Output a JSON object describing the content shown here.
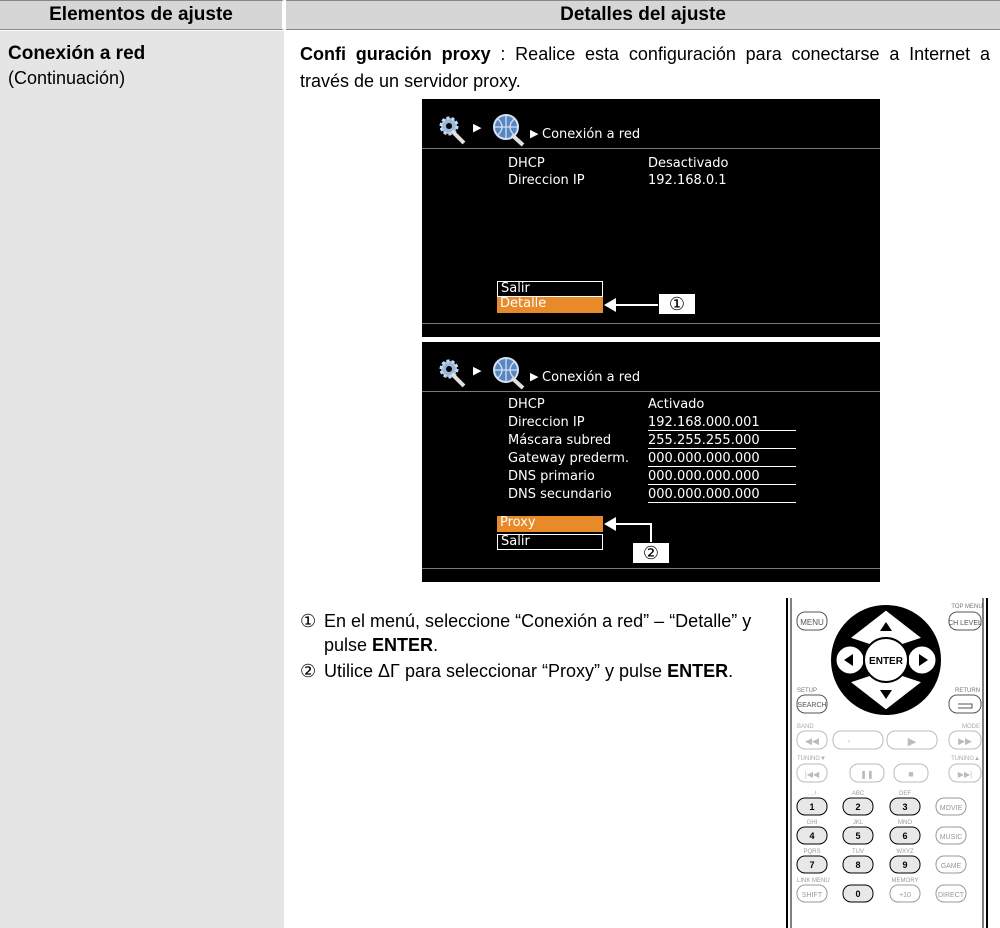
{
  "header": {
    "left": "Elementos de ajuste",
    "right": "Detalles del ajuste"
  },
  "left": {
    "title": "Conexión a red",
    "subtitle": "(Continuación)"
  },
  "intro": {
    "bold": "Confi guración proxy",
    "text": " : Realice esta configuración para conectarse a Internet a través de un servidor proxy."
  },
  "screen1": {
    "title": "Conexión a red",
    "rows": [
      {
        "label": "DHCP",
        "value": "Desactivado"
      },
      {
        "label": "Direccion IP",
        "value": "192.168.0.1"
      }
    ],
    "menu": [
      "Salir",
      "Detalle"
    ],
    "callout": "①"
  },
  "screen2": {
    "title": "Conexión a red",
    "rows": [
      {
        "label": "DHCP",
        "value": "Activado"
      },
      {
        "label": "Direccion IP",
        "value": "192.168.000.001"
      },
      {
        "label": "Máscara subred",
        "value": "255.255.255.000"
      },
      {
        "label": "Gateway prederm.",
        "value": "000.000.000.000"
      },
      {
        "label": "DNS primario",
        "value": "000.000.000.000"
      },
      {
        "label": "DNS secundario",
        "value": "000.000.000.000"
      }
    ],
    "menu": [
      "Proxy",
      "Salir"
    ],
    "callout": "②"
  },
  "steps": [
    {
      "num": "①",
      "text": "En el menú, seleccione “Conexión a red” – “Detalle” y pulse ",
      "key": "ENTER",
      "tail": "."
    },
    {
      "num": "②",
      "text": "Utilice ΔΓ para seleccionar “Proxy” y pulse ",
      "key": "ENTER",
      "tail": "."
    }
  ],
  "remote": {
    "menu": "MENU",
    "top_menu": "TOP MENU",
    "ch_level": "CH LEVEL",
    "enter": "ENTER",
    "setup": "SETUP",
    "search": "SEARCH",
    "return": "RETURN",
    "band": "BAND",
    "mode": "MODE",
    "tuning_down": "TUNING▼",
    "tuning_up": "TUNING▲",
    "keys": [
      {
        "top": ". , /",
        "key": "1"
      },
      {
        "top": "ABC",
        "key": "2"
      },
      {
        "top": "DEF",
        "key": "3"
      },
      {
        "top": "GHI",
        "key": "4"
      },
      {
        "top": "JKL",
        "key": "5"
      },
      {
        "top": "MNO",
        "key": "6"
      },
      {
        "top": "PQRS",
        "key": "7"
      },
      {
        "top": "TUV",
        "key": "8"
      },
      {
        "top": "WXYZ",
        "key": "9"
      }
    ],
    "side": [
      "MOVIE",
      "MUSIC",
      "GAME"
    ],
    "bottom": [
      "SHIFT",
      "0",
      "+10",
      "DIRECT"
    ],
    "link_menu": "LINK MENU",
    "memory": "MEMORY"
  },
  "colors": {
    "header_bg": "#d6d6d6",
    "left_bg": "#e5e5e5",
    "screen_bg": "#000000",
    "highlight": "#e8892a"
  }
}
